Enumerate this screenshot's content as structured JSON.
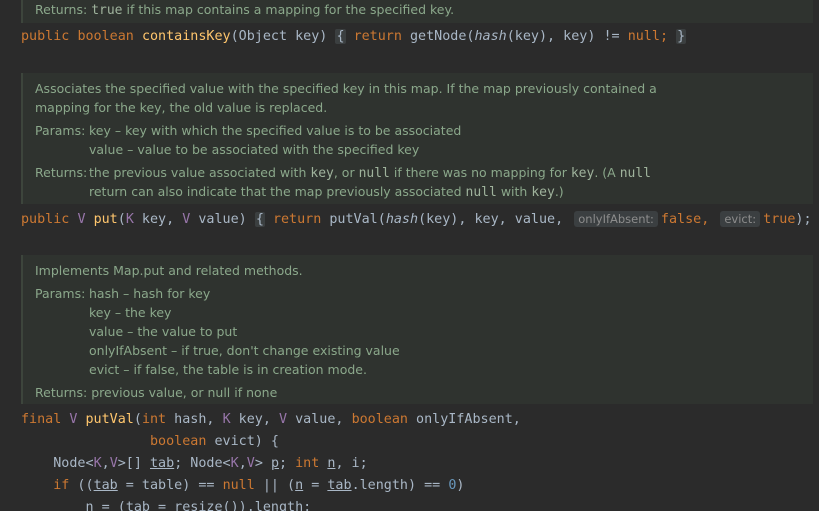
{
  "doc1": {
    "returns_label": "Returns:",
    "returns_code": "true",
    "returns_rest": "if this map contains a mapping for the specified key."
  },
  "line1": {
    "public": "public",
    "boolean": "boolean",
    "name": "containsKey",
    "params": "(Object key) ",
    "fold_open": "{",
    "return": "return",
    "getNode": " getNode(",
    "hash": "hash",
    "args": "(key), key) != ",
    "null": "null",
    "semi": ";",
    "fold_close": "}"
  },
  "doc2": {
    "desc1": "Associates the specified value with the specified key in this map. If the map previously contained a",
    "desc2": "mapping for the key, the old value is replaced.",
    "params_label": "Params:",
    "p1": "key – key with which the specified value is to be associated",
    "p2": "value – value to be associated with the specified key",
    "returns_label": "Returns:",
    "r1_a": "the previous value associated with",
    "r1_key": "key",
    "r1_b": ", or",
    "r1_null": "null",
    "r1_c": "if there was no mapping for",
    "r1_key2": "key",
    "r1_d": ". (A",
    "r1_null2": "null",
    "r2_a": "return can also indicate that the map previously associated",
    "r2_null": "null",
    "r2_b": "with",
    "r2_key": "key",
    "r2_c": ".)"
  },
  "line2": {
    "public": "public",
    "V": "V",
    "name": "put",
    "p_open": "(",
    "K": "K",
    "key": " key, ",
    "V2": "V",
    "value": " value) ",
    "fold_open": "{",
    "return": "return",
    "putVal": " putVal(",
    "hash": "hash",
    "args": "(key), key, value, ",
    "hint1": "onlyIfAbsent:",
    "false": "false",
    "comma": ", ",
    "hint2": "evict:",
    "true": "true",
    "end": ");",
    "fold_close": "}"
  },
  "doc3": {
    "desc": "Implements Map.put and related methods.",
    "params_label": "Params:",
    "p1": "hash – hash for key",
    "p2": "key – the key",
    "p3": "value – the value to put",
    "p4": "onlyIfAbsent – if true, don't change existing value",
    "p5": "evict – if false, the table is in creation mode.",
    "returns_label": "Returns:",
    "returns_text": "previous value, or null if none"
  },
  "line3": {
    "final": "final",
    "V": "V",
    "name": "putVal",
    "p_open": "(",
    "int": "int",
    "hash": " hash, ",
    "K": "K",
    "key": " key, ",
    "V2": "V",
    "value": " value, ",
    "boolean": "boolean",
    "only": " onlyIfAbsent,"
  },
  "line4": {
    "boolean": "boolean",
    "evict": " evict) {"
  },
  "line5": {
    "node1": "Node<",
    "K": "K",
    "c1": ",",
    "V": "V",
    "arr": ">[] ",
    "tab": "tab",
    "semi1": "; Node<",
    "K2": "K",
    "c2": ",",
    "V2": "V",
    "gt": "> ",
    "p": "p",
    "semi2": "; ",
    "int": "int",
    "sp": " ",
    "n": "n",
    "c3": ", i;"
  },
  "line6": {
    "if": "if",
    "open": " ((",
    "tab": "tab",
    "eq": " = table) == ",
    "null": "null",
    "or": " || (",
    "n": "n",
    "eq2": " = ",
    "tab2": "tab",
    "len": ".length) == ",
    "zero": "0",
    "close": ")"
  },
  "line7": {
    "n": "n",
    "rest": " = (",
    "tab": "tab",
    "rest2": " = resize()).length;"
  }
}
